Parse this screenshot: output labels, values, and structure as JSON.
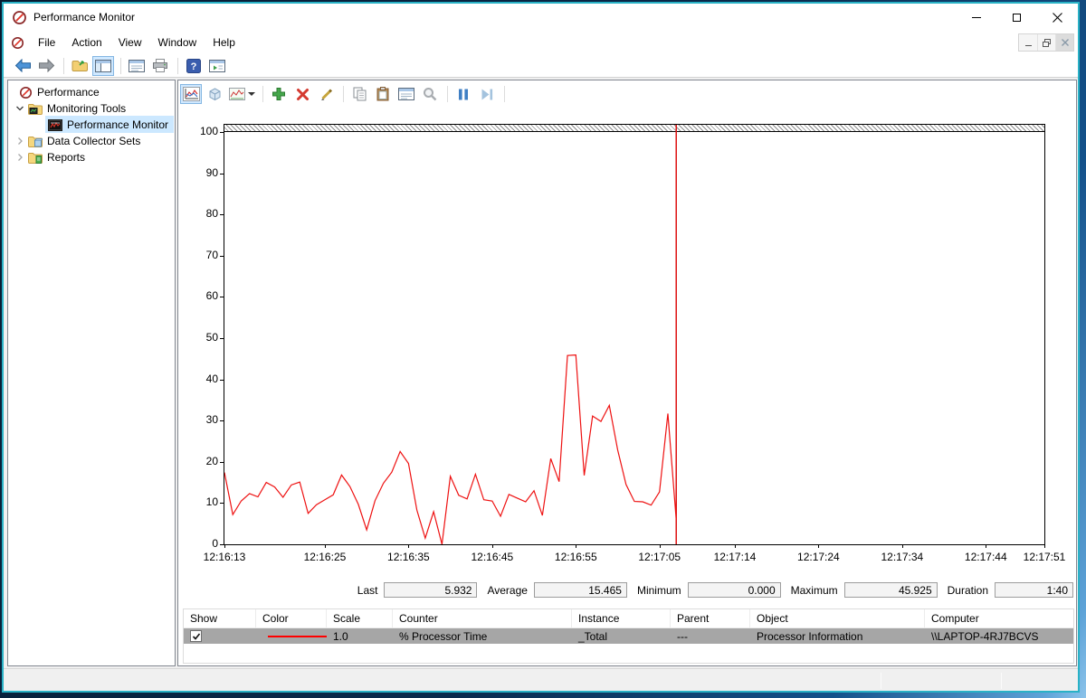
{
  "window": {
    "title": "Performance Monitor"
  },
  "menu": {
    "items": [
      "File",
      "Action",
      "View",
      "Window",
      "Help"
    ]
  },
  "tree": {
    "root_label": "Performance",
    "items": [
      {
        "label": "Monitoring Tools",
        "expanded": true
      },
      {
        "label": "Performance Monitor",
        "selected": true
      },
      {
        "label": "Data Collector Sets",
        "expanded": false
      },
      {
        "label": "Reports",
        "expanded": false
      }
    ]
  },
  "stats": {
    "last_label": "Last",
    "last": "5.932",
    "average_label": "Average",
    "average": "15.465",
    "minimum_label": "Minimum",
    "minimum": "0.000",
    "maximum_label": "Maximum",
    "maximum": "45.925",
    "duration_label": "Duration",
    "duration": "1:40"
  },
  "legend": {
    "headers": [
      "Show",
      "Color",
      "Scale",
      "Counter",
      "Instance",
      "Parent",
      "Object",
      "Computer"
    ],
    "row": {
      "checked": true,
      "color": "#ff0000",
      "scale": "1.0",
      "counter": "% Processor Time",
      "instance": "_Total",
      "parent": "---",
      "object": "Processor Information",
      "computer": "\\\\LAPTOP-4RJ7BCVS"
    }
  },
  "chart_data": {
    "type": "line",
    "title": "",
    "xlabel": "",
    "ylabel": "",
    "ylim": [
      0,
      100
    ],
    "grid": false,
    "legend_position": "bottom-table",
    "y_ticks": [
      0,
      10,
      20,
      30,
      40,
      50,
      60,
      70,
      80,
      90,
      100
    ],
    "x_window_seconds": 98,
    "x_ticks": [
      {
        "label": "12:16:13",
        "t": 0
      },
      {
        "label": "12:16:25",
        "t": 12
      },
      {
        "label": "12:16:35",
        "t": 22
      },
      {
        "label": "12:16:45",
        "t": 32
      },
      {
        "label": "12:16:55",
        "t": 42
      },
      {
        "label": "12:17:05",
        "t": 52
      },
      {
        "label": "12:17:14",
        "t": 61
      },
      {
        "label": "12:17:24",
        "t": 71
      },
      {
        "label": "12:17:34",
        "t": 81
      },
      {
        "label": "12:17:44",
        "t": 91
      },
      {
        "label": "12:17:51",
        "t": 98
      }
    ],
    "cursor_t": 54,
    "cursor_color": "#dd1111",
    "series": [
      {
        "name": "% Processor Time",
        "color": "#ee1111",
        "start_t": 0,
        "interval": 1,
        "values": [
          17.4,
          7.2,
          10.5,
          12.3,
          11.5,
          15.0,
          13.9,
          11.4,
          14.4,
          15.1,
          7.5,
          9.6,
          10.8,
          12.0,
          16.8,
          14.0,
          9.7,
          3.5,
          10.6,
          14.8,
          17.5,
          22.5,
          19.6,
          8.3,
          1.5,
          7.9,
          0.0,
          16.5,
          11.9,
          11.0,
          17.0,
          10.8,
          10.5,
          6.8,
          12.1,
          11.2,
          10.3,
          13.0,
          7.0,
          20.8,
          15.2,
          45.8,
          45.925,
          16.7,
          31.1,
          29.8,
          33.7,
          22.9,
          14.5,
          10.4,
          10.3,
          9.5,
          12.7,
          31.7,
          5.932
        ]
      }
    ]
  }
}
